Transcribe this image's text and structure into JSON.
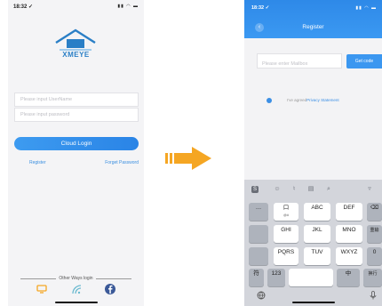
{
  "colors": {
    "accent": "#3d9bf0",
    "arrow": "#f5a623",
    "brand": "#2a7fc6"
  },
  "login_screen": {
    "status_time": "18:32 ✓",
    "brand": "XMEYE",
    "username_placeholder": "Please input UserName",
    "password_placeholder": "Please input password",
    "cloud_login": "Cloud Login",
    "register": "Register",
    "forget_password": "Forget Password",
    "other_ways": "Other Ways login",
    "social_icons": [
      "tv-icon",
      "wireless-icon",
      "facebook-icon"
    ]
  },
  "register_screen": {
    "status_time": "18:32 ✓",
    "title": "Register",
    "mailbox_placeholder": "Please enter Mailbox",
    "get_code": "Get code",
    "agree_text": "I've agreed",
    "privacy_statement": "Privacy Statement",
    "keyboard": {
      "row1": [
        {
          "main": "…"
        },
        {
          "main": "口",
          "sub": "@#"
        },
        {
          "main": "ABC"
        },
        {
          "main": "DEF"
        }
      ],
      "row2": [
        {
          "main": ""
        },
        {
          "main": "GHI"
        },
        {
          "main": "JKL"
        },
        {
          "main": "MNO"
        },
        {
          "main": "重输"
        }
      ],
      "row3": [
        {
          "main": ""
        },
        {
          "main": "PQRS"
        },
        {
          "main": "TUV"
        },
        {
          "main": "WXYZ"
        },
        {
          "main": "0"
        }
      ],
      "row4": [
        {
          "main": "符"
        },
        {
          "main": "123"
        },
        {
          "main": ""
        },
        {
          "main": "中"
        },
        {
          "main": "换行"
        }
      ]
    }
  }
}
